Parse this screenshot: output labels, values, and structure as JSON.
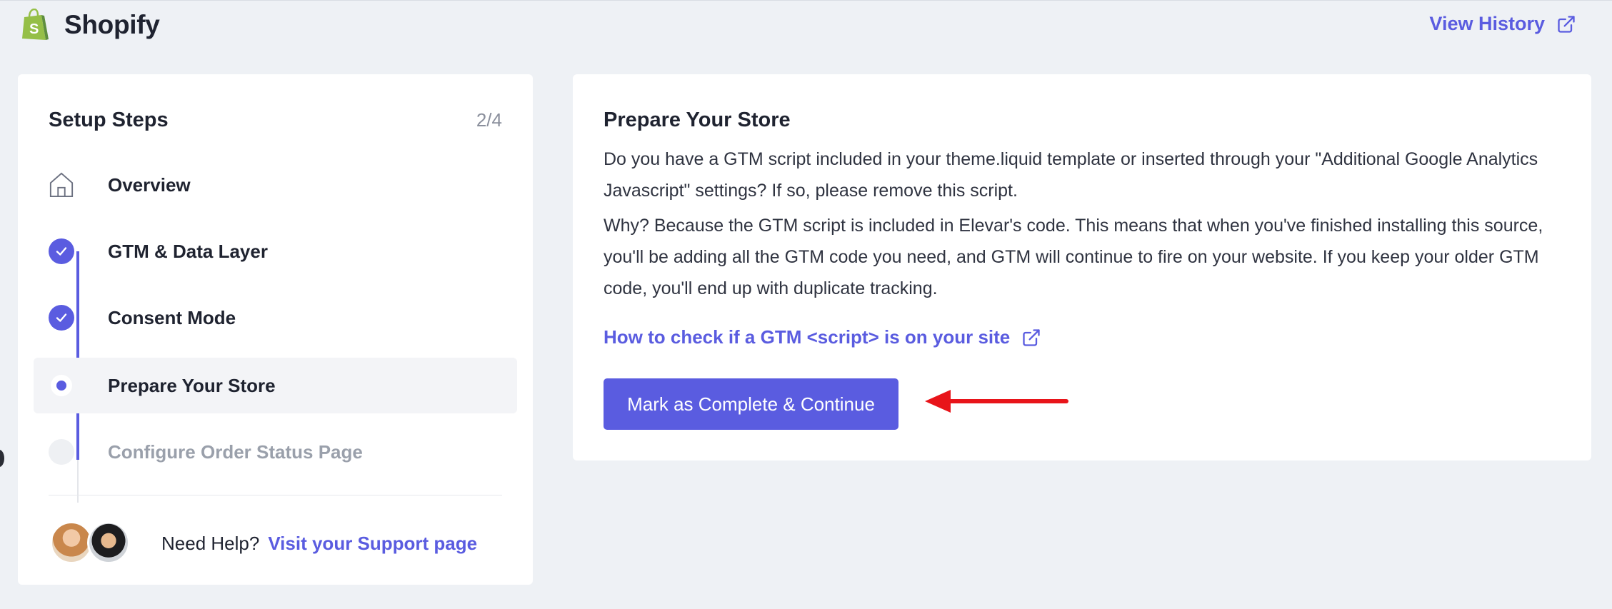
{
  "header": {
    "app_name": "Shopify",
    "view_history_label": "View History"
  },
  "sidebar": {
    "title": "Setup Steps",
    "progress": "2/4",
    "steps": [
      {
        "label": "Overview",
        "state": "overview"
      },
      {
        "label": "GTM & Data Layer",
        "state": "done"
      },
      {
        "label": "Consent Mode",
        "state": "done"
      },
      {
        "label": "Prepare Your Store",
        "state": "current"
      },
      {
        "label": "Configure Order Status Page",
        "state": "pending"
      }
    ],
    "help": {
      "text": "Need Help?",
      "link_label": "Visit your Support page"
    }
  },
  "main": {
    "title": "Prepare Your Store",
    "paragraph_1": "Do you have a GTM script included in your theme.liquid template or inserted through your \"Additional Google Analytics Javascript\" settings? If so, please remove this script.",
    "paragraph_2": "Why? Because the GTM script is included in Elevar's code. This means that when you've finished installing this source, you'll be adding all the GTM code you need, and GTM will continue to fire on your website. If you keep your older GTM code, you'll end up with duplicate tracking.",
    "guide_link_label": "How to check if a GTM <script> is on your site",
    "primary_button_label": "Mark as Complete & Continue"
  },
  "colors": {
    "accent": "#5a5ce0",
    "background": "#eef1f5",
    "annotation_arrow": "#e8141a",
    "shopify_green": "#95bf47"
  },
  "icons": {
    "logo": "shopify-bag-icon",
    "external": "external-link-icon",
    "overview": "home-icon",
    "done": "checkmark-icon"
  }
}
